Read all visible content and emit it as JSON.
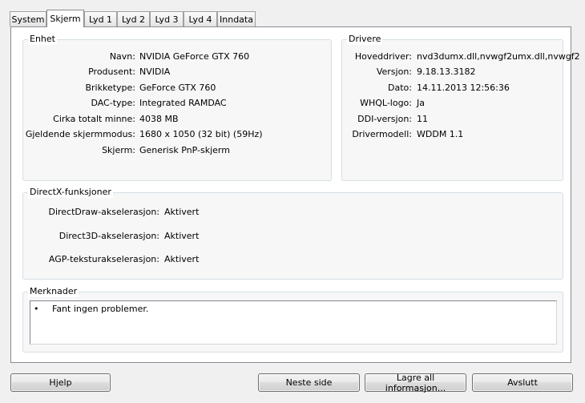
{
  "tabs": [
    {
      "label": "System",
      "active": false
    },
    {
      "label": "Skjerm",
      "active": true
    },
    {
      "label": "Lyd 1",
      "active": false
    },
    {
      "label": "Lyd 2",
      "active": false
    },
    {
      "label": "Lyd 3",
      "active": false
    },
    {
      "label": "Lyd 4",
      "active": false
    },
    {
      "label": "Inndata",
      "active": false
    }
  ],
  "device": {
    "title": "Enhet",
    "rows": [
      {
        "label": "Navn:",
        "value": "NVIDIA GeForce GTX 760"
      },
      {
        "label": "Produsent:",
        "value": "NVIDIA"
      },
      {
        "label": "Brikketype:",
        "value": "GeForce GTX 760"
      },
      {
        "label": "DAC-type:",
        "value": "Integrated RAMDAC"
      },
      {
        "label": "Cirka totalt minne:",
        "value": "4038 MB"
      },
      {
        "label": "Gjeldende skjermmodus:",
        "value": "1680 x 1050 (32 bit) (59Hz)"
      },
      {
        "label": "Skjerm:",
        "value": "Generisk PnP-skjerm"
      }
    ]
  },
  "drivers": {
    "title": "Drivere",
    "rows": [
      {
        "label": "Hoveddriver:",
        "value": "nvd3dumx.dll,nvwgf2umx.dll,nvwgf2"
      },
      {
        "label": "Versjon:",
        "value": "9.18.13.3182"
      },
      {
        "label": "Dato:",
        "value": "14.11.2013 12:56:36"
      },
      {
        "label": "WHQL-logo:",
        "value": "Ja"
      },
      {
        "label": "DDI-versjon:",
        "value": "11"
      },
      {
        "label": "Drivermodell:",
        "value": "WDDM 1.1"
      }
    ]
  },
  "directx": {
    "title": "DirectX-funksjoner",
    "rows": [
      {
        "label": "DirectDraw-akselerasjon:",
        "value": "Aktivert"
      },
      {
        "label": "Direct3D-akselerasjon:",
        "value": "Aktivert"
      },
      {
        "label": "AGP-teksturakselerasjon:",
        "value": "Aktivert"
      }
    ]
  },
  "notes": {
    "title": "Merknader",
    "bullet": "•",
    "items": [
      "Fant ingen problemer."
    ]
  },
  "buttons": {
    "help": "Hjelp",
    "next": "Neste side",
    "save": "Lagre all informasjon...",
    "exit": "Avslutt"
  }
}
